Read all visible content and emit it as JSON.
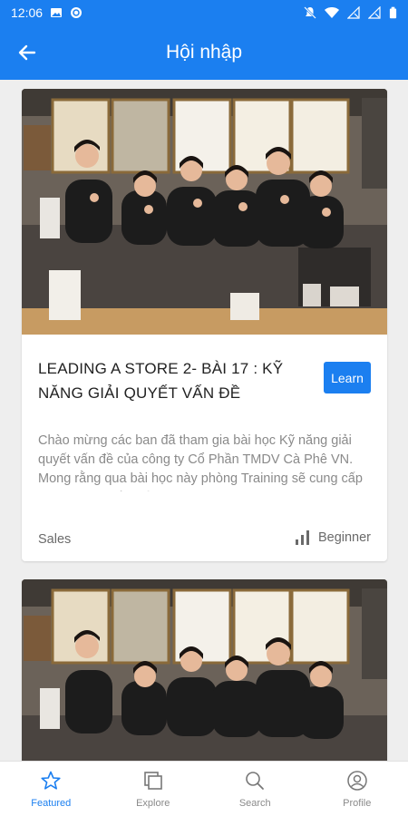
{
  "status_bar": {
    "time": "12:06",
    "icons": [
      "image-icon",
      "sync-icon",
      "mute-icon",
      "wifi-icon",
      "signal-off-icon",
      "signal-off-icon",
      "battery-icon"
    ]
  },
  "app_bar": {
    "title": "Hội nhập",
    "back_icon": "arrow-left-icon"
  },
  "courses": [
    {
      "title": "LEADING A STORE 2- BÀI 17 : KỸ NĂNG GIẢI QUYẾT VẤN ĐỀ",
      "action_label": "Learn",
      "description": "Chào mừng các ban đã tham gia bài học Kỹ năng giải quyết vấn đề của công ty Cổ Phần TMDV Cà Phê VN. Mong rằng qua bài học này phòng Training sẽ cung cấp cho các bạn đầy đủ thông tin giúp các bạn",
      "category": "Sales",
      "level": "Beginner",
      "image": "team-photo"
    },
    {
      "image": "team-photo"
    }
  ],
  "bottom_nav": [
    {
      "label": "Featured",
      "icon": "star-icon",
      "active": true
    },
    {
      "label": "Explore",
      "icon": "explore-icon",
      "active": false
    },
    {
      "label": "Search",
      "icon": "search-icon",
      "active": false
    },
    {
      "label": "Profile",
      "icon": "profile-icon",
      "active": false
    }
  ],
  "colors": {
    "primary": "#1b7ff0",
    "background": "#eeeeee",
    "inactive": "#8a8a8a"
  }
}
